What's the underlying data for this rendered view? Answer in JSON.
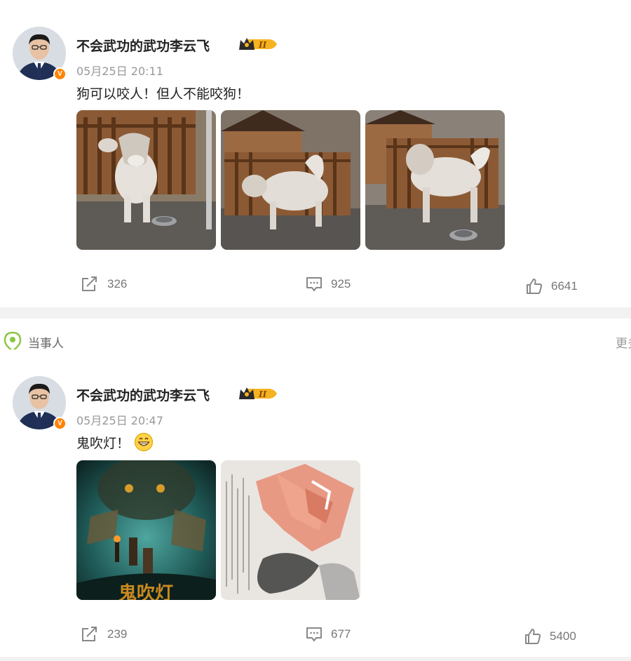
{
  "posts": [
    {
      "username": "不会武功的武功李云飞",
      "badge": "II",
      "verified": "V",
      "time": "05月25日 20:11",
      "text": "狗可以咬人！但人不能咬狗！",
      "photos": [
        "dog-photo-1",
        "dog-photo-2",
        "dog-photo-3"
      ],
      "reposts": "326",
      "comments": "925",
      "likes": "6641"
    },
    {
      "username": "不会武功的武功李云飞",
      "badge": "II",
      "verified": "V",
      "time": "05月25日 20:47",
      "text": "鬼吹灯！",
      "emoji": "grinning-emoji",
      "photos": [
        "movie-poster-photo",
        "ink-painting-photo"
      ],
      "reposts": "239",
      "comments": "677",
      "likes": "5400"
    }
  ],
  "topic_bar": {
    "label": "当事人",
    "more": "更多"
  },
  "colors": {
    "accent_orange": "#ff8200",
    "badge_gold": "#f5b321",
    "topic_green": "#8cc63f",
    "muted_text": "#999999"
  }
}
